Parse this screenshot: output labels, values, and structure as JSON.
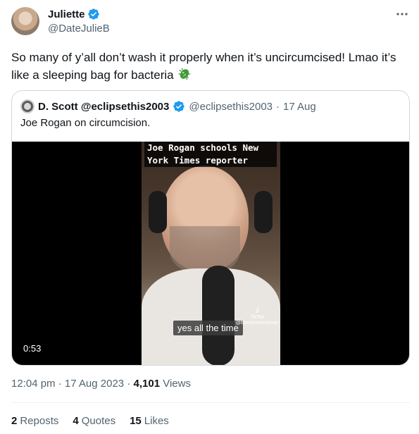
{
  "author": {
    "name": "Juliette",
    "handle": "@DateJulieB"
  },
  "tweet": {
    "text": "So many of y’all don’t wash it properly when it’s uncircumcised! Lmao it’s like a sleeping bag for bacteria",
    "emoji_icon": "microbe-icon"
  },
  "quoted": {
    "name": "D. Scott @eclipsethis2003",
    "handle": "@eclipsethis2003",
    "separator": "·",
    "date": "17 Aug",
    "text": "Joe Rogan on circumcision.",
    "video": {
      "caption": "Joe Rogan schools New York Times reporter",
      "subtitle": "yes all the time",
      "watermark_logo": "TikTok",
      "watermark_user": "@bloodsinincolman",
      "duration": "0:53"
    }
  },
  "meta": {
    "time": "12:04 pm",
    "sep1": "·",
    "date": "17 Aug 2023",
    "sep2": "·",
    "views_count": "4,101",
    "views_label": "Views"
  },
  "stats": {
    "reposts_count": "2",
    "reposts_label": "Reposts",
    "quotes_count": "4",
    "quotes_label": "Quotes",
    "likes_count": "15",
    "likes_label": "Likes"
  },
  "colors": {
    "verified": "#1d9bf0",
    "secondary_text": "#536471",
    "primary_text": "#0f1419",
    "border": "#cfd9de"
  }
}
